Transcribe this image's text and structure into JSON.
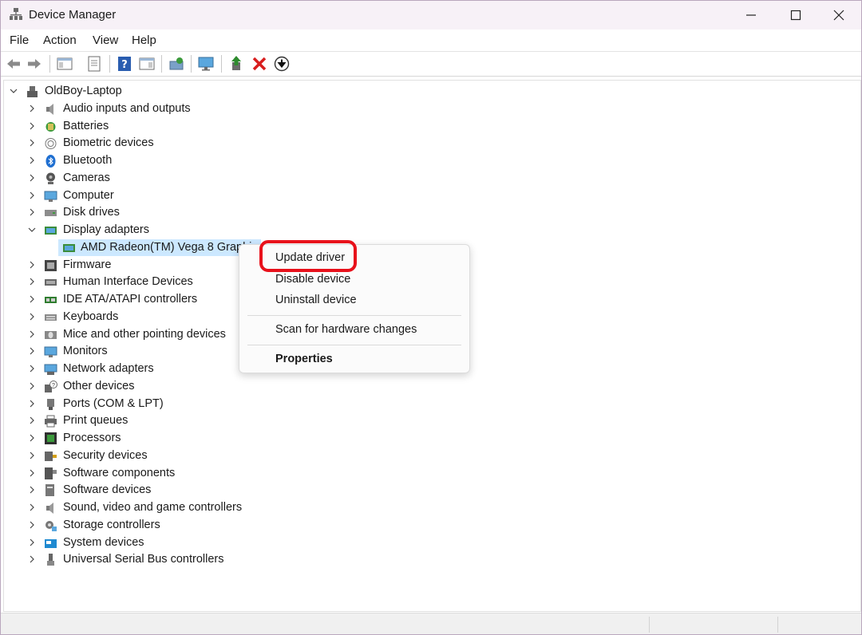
{
  "window": {
    "title": "Device Manager"
  },
  "menubar": {
    "items": [
      "File",
      "Action",
      "View",
      "Help"
    ]
  },
  "toolbar": {
    "buttons": [
      "back-icon",
      "forward-icon",
      "show-hide-console-tree-icon",
      "properties-icon",
      "help-icon",
      "action-pane-icon",
      "scan-hardware-icon",
      "monitor-icon",
      "update-driver-icon",
      "uninstall-icon",
      "download-icon"
    ],
    "uninstall_color": "#d81e1e",
    "update_color": "#2e8b2e"
  },
  "tree": {
    "root": "OldBoy-Laptop",
    "categories": [
      {
        "label": "Audio inputs and outputs",
        "icon": "speaker-icon",
        "expanded": false
      },
      {
        "label": "Batteries",
        "icon": "battery-icon",
        "expanded": false
      },
      {
        "label": "Biometric devices",
        "icon": "fingerprint-icon",
        "expanded": false
      },
      {
        "label": "Bluetooth",
        "icon": "bluetooth-icon",
        "expanded": false
      },
      {
        "label": "Cameras",
        "icon": "camera-icon",
        "expanded": false
      },
      {
        "label": "Computer",
        "icon": "computer-icon",
        "expanded": false
      },
      {
        "label": "Disk drives",
        "icon": "disk-icon",
        "expanded": false
      },
      {
        "label": "Display adapters",
        "icon": "display-adapter-icon",
        "expanded": true
      },
      {
        "label": "Firmware",
        "icon": "firmware-icon",
        "expanded": false
      },
      {
        "label": "Human Interface Devices",
        "icon": "hid-icon",
        "expanded": false
      },
      {
        "label": "IDE ATA/ATAPI controllers",
        "icon": "ide-controller-icon",
        "expanded": false
      },
      {
        "label": "Keyboards",
        "icon": "keyboard-icon",
        "expanded": false
      },
      {
        "label": "Mice and other pointing devices",
        "icon": "mouse-icon",
        "expanded": false
      },
      {
        "label": "Monitors",
        "icon": "monitor-icon",
        "expanded": false
      },
      {
        "label": "Network adapters",
        "icon": "network-adapter-icon",
        "expanded": false
      },
      {
        "label": "Other devices",
        "icon": "unknown-device-icon",
        "expanded": false
      },
      {
        "label": "Ports (COM & LPT)",
        "icon": "port-icon",
        "expanded": false
      },
      {
        "label": "Print queues",
        "icon": "printer-icon",
        "expanded": false
      },
      {
        "label": "Processors",
        "icon": "processor-icon",
        "expanded": false
      },
      {
        "label": "Security devices",
        "icon": "security-device-icon",
        "expanded": false
      },
      {
        "label": "Software components",
        "icon": "software-component-icon",
        "expanded": false
      },
      {
        "label": "Software devices",
        "icon": "software-device-icon",
        "expanded": false
      },
      {
        "label": "Sound, video and game controllers",
        "icon": "sound-controller-icon",
        "expanded": false
      },
      {
        "label": "Storage controllers",
        "icon": "storage-controller-icon",
        "expanded": false
      },
      {
        "label": "System devices",
        "icon": "system-device-icon",
        "expanded": false
      },
      {
        "label": "Universal Serial Bus controllers",
        "icon": "usb-icon",
        "expanded": false
      }
    ],
    "selected_device": "AMD Radeon(TM) Vega 8 Graphi"
  },
  "context_menu": {
    "update": "Update driver",
    "disable": "Disable device",
    "uninstall": "Uninstall device",
    "scan": "Scan for hardware changes",
    "properties": "Properties",
    "highlight_color": "#e8111b"
  },
  "colors": {
    "selection": "#cce8ff",
    "titlebar": "#f7f1f7"
  }
}
